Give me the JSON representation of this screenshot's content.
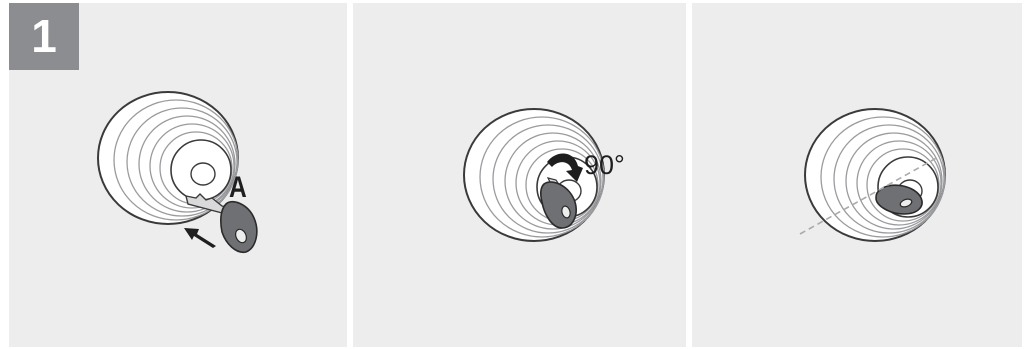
{
  "step": {
    "number": "1"
  },
  "labels": {
    "key_label": "A",
    "rotation": "90°"
  },
  "colors": {
    "panel_bg": "#ededee",
    "step_box": "#8c8d90",
    "key_fill": "#6f7073",
    "line": "#3a3a3a",
    "dashed_line": "#a9aaad"
  },
  "panels": [
    {
      "content": "lock-with-key-inserting-icon"
    },
    {
      "content": "lock-with-key-turning-icon"
    },
    {
      "content": "lock-with-key-turned-icon"
    }
  ]
}
